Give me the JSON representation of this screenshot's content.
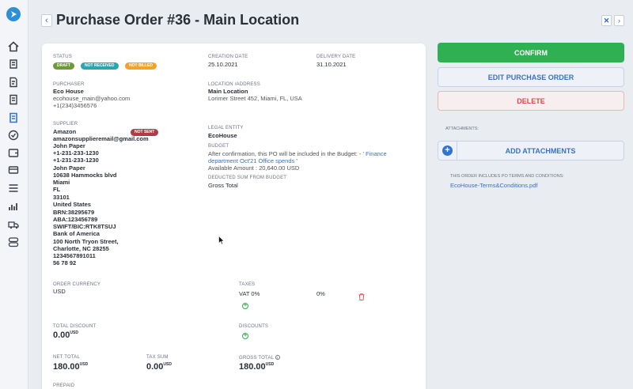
{
  "header": {
    "title": "Purchase Order #36 - Main Location",
    "back_icon": "chevron-left-icon",
    "close_icon": "close-icon",
    "next_icon": "chevron-right-icon"
  },
  "sidebar": {
    "logo": "app-logo",
    "items": [
      {
        "icon": "home-icon"
      },
      {
        "icon": "order-icon"
      },
      {
        "icon": "document-icon"
      },
      {
        "icon": "invoice-icon"
      },
      {
        "icon": "purchase-order-icon"
      },
      {
        "icon": "check-circle-icon"
      },
      {
        "icon": "wallet-icon"
      },
      {
        "icon": "card-icon"
      },
      {
        "icon": "list-icon"
      },
      {
        "icon": "chart-icon"
      },
      {
        "icon": "truck-icon"
      },
      {
        "icon": "toggle-icon"
      }
    ]
  },
  "status": {
    "label": "STATUS",
    "badges": [
      {
        "text": "DRAFT",
        "color": "#6f9a3a"
      },
      {
        "text": "NOT RECEIVED",
        "color": "#2aa6b3"
      },
      {
        "text": "NOT BILLED",
        "color": "#f0a52a"
      }
    ]
  },
  "creation_date": {
    "label": "CREATION DATE",
    "value": "25.10.2021"
  },
  "delivery_date": {
    "label": "DELIVERY DATE",
    "value": "31.10.2021"
  },
  "purchaser": {
    "label": "PURCHASER",
    "name": "Eco House",
    "email": "ecohouse_main@yahoo.com",
    "phone": "+1(234)3456576"
  },
  "location": {
    "label": "LOCATION /ADDRESS",
    "name": "Main Location",
    "address": "Lorimer Street 452, Miami, FL, USA"
  },
  "supplier": {
    "label": "SUPPLIER",
    "badge": "NOT SENT",
    "badge_color": "#b03a48",
    "lines": [
      "Amazon",
      "amazonsupplieremail@gmail.com",
      "John Paper",
      "+1-231-233-1230",
      "+1-231-233-1230",
      "John Paper",
      "10638 Hammocks blvd",
      "Miami",
      "FL",
      "33101",
      "United States",
      "BRN:38295679",
      "ABA:123456789",
      "SWIFT/BIC:RTK8TSUJ",
      "Bank of America",
      "100 North Tryon Street,",
      "Charlotte, NC 28255",
      "1234567891011",
      "56 78 92"
    ]
  },
  "legal_entity": {
    "label": "LEGAL ENTITY",
    "value": "EcoHouse"
  },
  "budget": {
    "label": "BUDGET",
    "text_prefix": "After confirmation, this PO will be included in the Budget: - '",
    "link_part1": "Finance",
    "link_part2": "department Oct'21 Office spends",
    "text_suffix": "'",
    "available": "Available Amount : 20,640.00 USD"
  },
  "deducted": {
    "label": "DEDUCTED SUM FROM BUDGET",
    "value": "Gross Total"
  },
  "currency": {
    "label": "ORDER CURRENCY",
    "value": "USD"
  },
  "taxes": {
    "label": "TAXES",
    "name": "VAT 0%",
    "rate": "0%",
    "delete_icon": "trash-icon",
    "add_icon": "plus-circle-icon"
  },
  "total_discount": {
    "label": "TOTAL DISCOUNT",
    "value": "0.00",
    "unit": "USD"
  },
  "discounts": {
    "label": "DISCOUNTS",
    "add_icon": "plus-circle-icon"
  },
  "net_total": {
    "label": "NET TOTAL",
    "value": "180.00",
    "unit": "USD"
  },
  "tax_sum": {
    "label": "TAX SUM",
    "value": "0.00",
    "unit": "USD"
  },
  "gross_total": {
    "label": "GROSS TOTAL",
    "value": "180.00",
    "unit": "USD",
    "info_icon": "info-icon"
  },
  "prepaid": {
    "label": "PREPAID"
  },
  "actions": {
    "confirm": "CONFIRM",
    "edit": "EDIT PURCHASE ORDER",
    "delete": "DELETE",
    "attachments_label": "ATTACHMENTS:",
    "add_attachments": "ADD ATTACHMENTS",
    "terms_label": "THIS ORDER INCLUDES PO TERMS AND CONDITIONS:",
    "terms_link": "EcoHouse-Terms&Conditions.pdf"
  },
  "colors": {
    "confirm": "#2fb052",
    "accent": "#3a70c5",
    "danger": "#e04848"
  }
}
